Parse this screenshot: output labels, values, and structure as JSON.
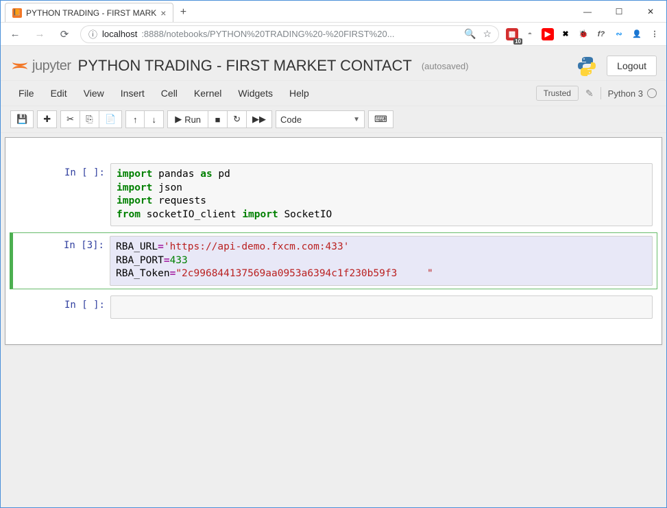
{
  "browser": {
    "tab_title": "PYTHON TRADING - FIRST MARK",
    "url_host": "localhost",
    "url_port_path": ":8888/notebooks/PYTHON%20TRADING%20-%20FIRST%20...",
    "extension_badge": "10"
  },
  "window_controls": {
    "minimize": "—",
    "maximize": "☐",
    "close": "✕"
  },
  "jupyter": {
    "logo_text": "jupyter",
    "notebook_title": "PYTHON TRADING - FIRST MARKET CONTACT",
    "autosaved": "(autosaved)",
    "logout": "Logout",
    "trusted": "Trusted",
    "kernel_name": "Python 3"
  },
  "menubar": {
    "items": [
      "File",
      "Edit",
      "View",
      "Insert",
      "Cell",
      "Kernel",
      "Widgets",
      "Help"
    ]
  },
  "toolbar": {
    "run_label": "Run",
    "celltype": "Code"
  },
  "cells": [
    {
      "prompt": "In [ ]:",
      "lines": [
        [
          {
            "t": "import",
            "c": "kw"
          },
          {
            "t": " pandas ",
            "c": "nm"
          },
          {
            "t": "as",
            "c": "kw"
          },
          {
            "t": " pd",
            "c": "nm"
          }
        ],
        [
          {
            "t": "import",
            "c": "kw"
          },
          {
            "t": " json",
            "c": "nm"
          }
        ],
        [
          {
            "t": "import",
            "c": "kw"
          },
          {
            "t": " requests",
            "c": "nm"
          }
        ],
        [
          {
            "t": "from",
            "c": "kw"
          },
          {
            "t": " socketIO_client ",
            "c": "nm"
          },
          {
            "t": "import",
            "c": "kw"
          },
          {
            "t": " SocketIO",
            "c": "nm"
          }
        ]
      ],
      "selected": false
    },
    {
      "prompt": "In [3]:",
      "lines": [
        [
          {
            "t": "RBA_URL",
            "c": "nm"
          },
          {
            "t": "=",
            "c": "op"
          },
          {
            "t": "'https://api-demo.fxcm.com:433'",
            "c": "str"
          }
        ],
        [
          {
            "t": "RBA_PORT",
            "c": "nm"
          },
          {
            "t": "=",
            "c": "op"
          },
          {
            "t": "433",
            "c": "num"
          }
        ],
        [
          {
            "t": "RBA_Token",
            "c": "nm"
          },
          {
            "t": "=",
            "c": "op"
          },
          {
            "t": "\"2c996844137569aa0953a6394c1f230b59f3     \"",
            "c": "str"
          }
        ]
      ],
      "selected": true
    },
    {
      "prompt": "In [ ]:",
      "lines": [
        []
      ],
      "selected": false
    }
  ]
}
